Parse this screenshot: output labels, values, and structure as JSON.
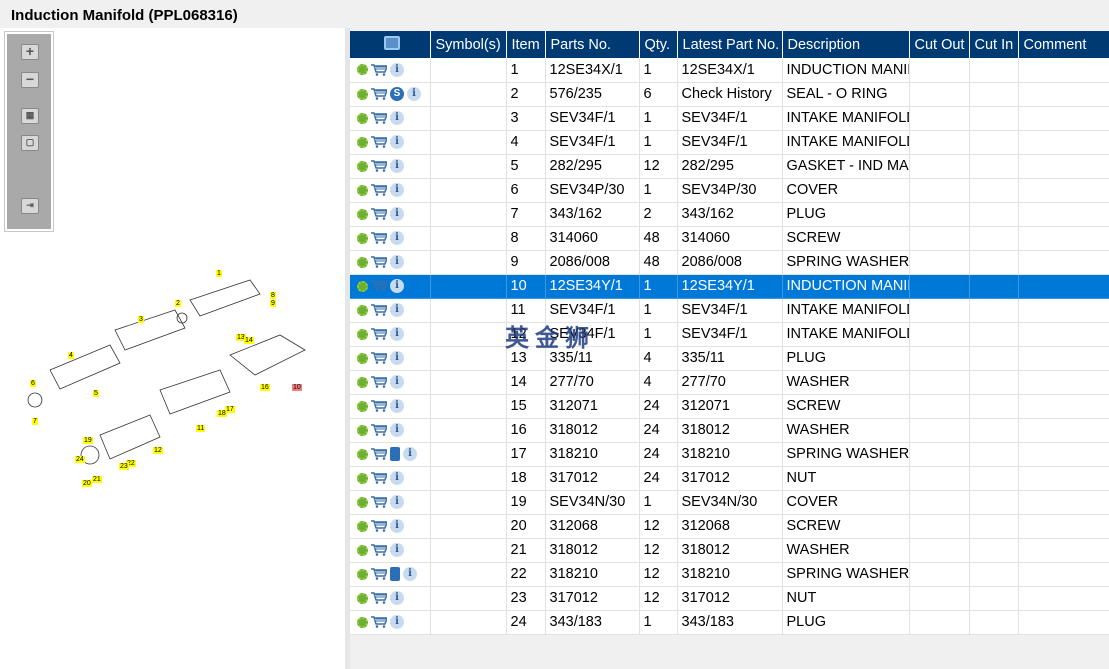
{
  "title": "Induction Manifold (PPL068316)",
  "toolbar": {
    "zoom_in": "+",
    "zoom_out": "−"
  },
  "columns": [
    "Symbol(s)",
    "Item",
    "Parts No.",
    "Qty.",
    "Latest Part No.",
    "Description",
    "Cut Out",
    "Cut In",
    "Comment"
  ],
  "rows": [
    {
      "icons": [
        "gear",
        "cart",
        "info"
      ],
      "item": "1",
      "part": "12SE34X/1",
      "qty": "1",
      "latest": "12SE34X/1",
      "desc": "INDUCTION MANIFOLD"
    },
    {
      "icons": [
        "gear",
        "cart",
        "s",
        "info"
      ],
      "item": "2",
      "part": "576/235",
      "qty": "6",
      "latest": "Check History",
      "desc": "SEAL - O RING"
    },
    {
      "icons": [
        "gear",
        "cart",
        "info"
      ],
      "item": "3",
      "part": "SEV34F/1",
      "qty": "1",
      "latest": "SEV34F/1",
      "desc": "INTAKE MANIFOLD"
    },
    {
      "icons": [
        "gear",
        "cart",
        "info"
      ],
      "item": "4",
      "part": "SEV34F/1",
      "qty": "1",
      "latest": "SEV34F/1",
      "desc": "INTAKE MANIFOLD"
    },
    {
      "icons": [
        "gear",
        "cart",
        "info"
      ],
      "item": "5",
      "part": "282/295",
      "qty": "12",
      "latest": "282/295",
      "desc": "GASKET - IND MANIFOLD"
    },
    {
      "icons": [
        "gear",
        "cart",
        "info"
      ],
      "item": "6",
      "part": "SEV34P/30",
      "qty": "1",
      "latest": "SEV34P/30",
      "desc": "COVER"
    },
    {
      "icons": [
        "gear",
        "cart",
        "info"
      ],
      "item": "7",
      "part": "343/162",
      "qty": "2",
      "latest": "343/162",
      "desc": "PLUG"
    },
    {
      "icons": [
        "gear",
        "cart",
        "info"
      ],
      "item": "8",
      "part": "314060",
      "qty": "48",
      "latest": "314060",
      "desc": "SCREW"
    },
    {
      "icons": [
        "gear",
        "cart",
        "info"
      ],
      "item": "9",
      "part": "2086/008",
      "qty": "48",
      "latest": "2086/008",
      "desc": "SPRING WASHER"
    },
    {
      "icons": [
        "gear",
        "cart",
        "info"
      ],
      "item": "10",
      "part": "12SE34Y/1",
      "qty": "1",
      "latest": "12SE34Y/1",
      "desc": "INDUCTION MANIFOLD",
      "selected": true
    },
    {
      "icons": [
        "gear",
        "cart",
        "info"
      ],
      "item": "11",
      "part": "SEV34F/1",
      "qty": "1",
      "latest": "SEV34F/1",
      "desc": "INTAKE MANIFOLD"
    },
    {
      "icons": [
        "gear",
        "cart",
        "info"
      ],
      "item": "12",
      "part": "SEV34F/1",
      "qty": "1",
      "latest": "SEV34F/1",
      "desc": "INTAKE MANIFOLD"
    },
    {
      "icons": [
        "gear",
        "cart",
        "info"
      ],
      "item": "13",
      "part": "335/11",
      "qty": "4",
      "latest": "335/11",
      "desc": "PLUG"
    },
    {
      "icons": [
        "gear",
        "cart",
        "info"
      ],
      "item": "14",
      "part": "277/70",
      "qty": "4",
      "latest": "277/70",
      "desc": "WASHER"
    },
    {
      "icons": [
        "gear",
        "cart",
        "info"
      ],
      "item": "15",
      "part": "312071",
      "qty": "24",
      "latest": "312071",
      "desc": "SCREW"
    },
    {
      "icons": [
        "gear",
        "cart",
        "info"
      ],
      "item": "16",
      "part": "318012",
      "qty": "24",
      "latest": "318012",
      "desc": "WASHER"
    },
    {
      "icons": [
        "gear",
        "cart",
        "book",
        "info"
      ],
      "item": "17",
      "part": "318210",
      "qty": "24",
      "latest": "318210",
      "desc": "SPRING WASHER"
    },
    {
      "icons": [
        "gear",
        "cart",
        "info"
      ],
      "item": "18",
      "part": "317012",
      "qty": "24",
      "latest": "317012",
      "desc": "NUT"
    },
    {
      "icons": [
        "gear",
        "cart",
        "info"
      ],
      "item": "19",
      "part": "SEV34N/30",
      "qty": "1",
      "latest": "SEV34N/30",
      "desc": "COVER"
    },
    {
      "icons": [
        "gear",
        "cart",
        "info"
      ],
      "item": "20",
      "part": "312068",
      "qty": "12",
      "latest": "312068",
      "desc": "SCREW"
    },
    {
      "icons": [
        "gear",
        "cart",
        "info"
      ],
      "item": "21",
      "part": "318012",
      "qty": "12",
      "latest": "318012",
      "desc": "WASHER"
    },
    {
      "icons": [
        "gear",
        "cart",
        "book",
        "info"
      ],
      "item": "22",
      "part": "318210",
      "qty": "12",
      "latest": "318210",
      "desc": "SPRING WASHER"
    },
    {
      "icons": [
        "gear",
        "cart",
        "info"
      ],
      "item": "23",
      "part": "317012",
      "qty": "12",
      "latest": "317012",
      "desc": "NUT"
    },
    {
      "icons": [
        "gear",
        "cart",
        "info"
      ],
      "item": "24",
      "part": "343/183",
      "qty": "1",
      "latest": "343/183",
      "desc": "PLUG"
    }
  ],
  "watermark": "英金狮",
  "callouts": [
    "1",
    "2",
    "3",
    "4",
    "5",
    "6",
    "7",
    "8",
    "9",
    "11",
    "12",
    "13",
    "14",
    "16",
    "17",
    "18",
    "19",
    "20",
    "21",
    "22",
    "23",
    "24",
    "10"
  ],
  "colors": {
    "header": "#003a73",
    "selected": "#0078d7"
  }
}
